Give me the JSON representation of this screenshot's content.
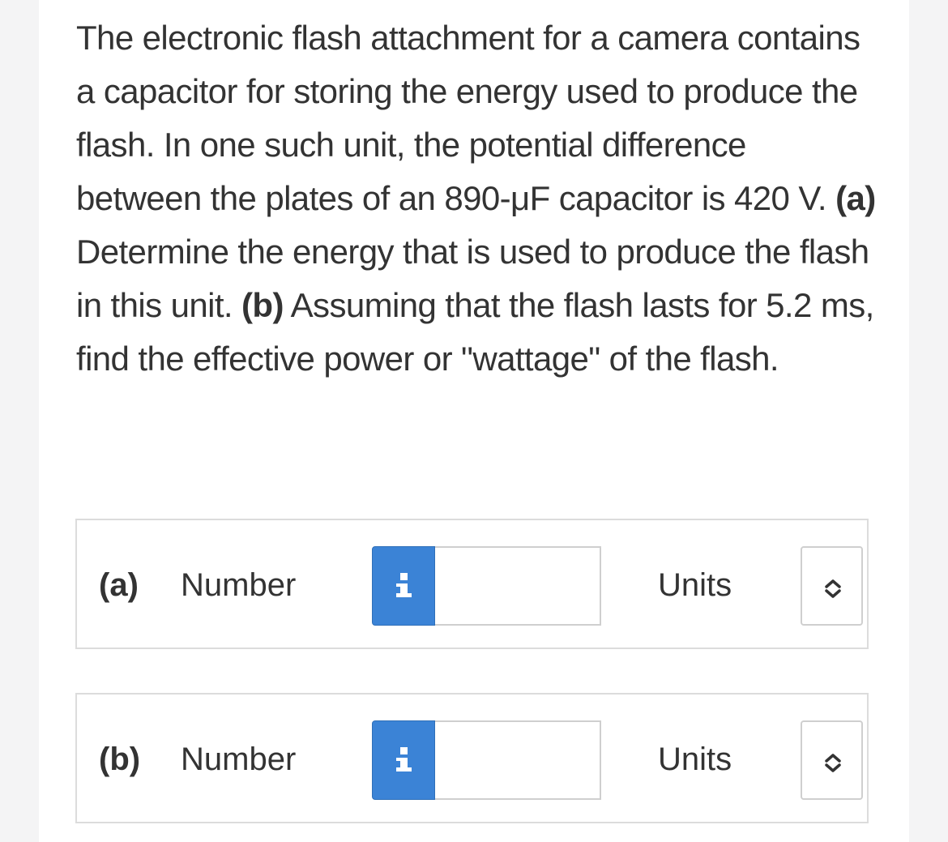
{
  "question": {
    "intro": "The electronic flash attachment for a camera contains a capacitor for storing the energy used to produce the flash. In one such unit, the potential difference between the plates of an 890-μF capacitor is 420 V. ",
    "part_a_marker": "(a)",
    "part_a_text": " Determine the energy that is used to produce the flash in this unit. ",
    "part_b_marker": "(b)",
    "part_b_text": " Assuming that the flash lasts for 5.2 ms, find the effective power or \"wattage\" of the flash."
  },
  "answers": [
    {
      "part_label": "(a)",
      "number_label": "Number",
      "info_icon": "info-icon",
      "number_value": "",
      "units_label": "Units",
      "units_selected": "",
      "select_icon": "up-down-chevron-icon"
    },
    {
      "part_label": "(b)",
      "number_label": "Number",
      "info_icon": "info-icon",
      "number_value": "",
      "units_label": "Units",
      "units_selected": "",
      "select_icon": "up-down-chevron-icon"
    }
  ],
  "colors": {
    "info_button": "#3b83d6",
    "text": "#333333",
    "border": "#dcdcdc"
  }
}
